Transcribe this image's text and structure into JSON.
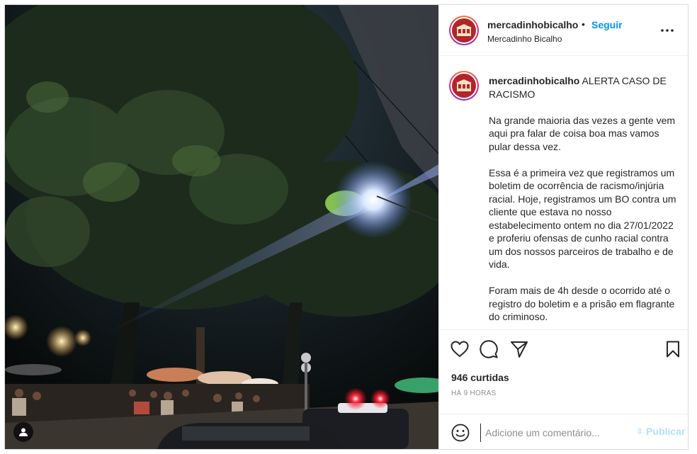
{
  "post": {
    "header": {
      "username": "mercadinhobicalho",
      "separator": "•",
      "follow_label": "Seguir",
      "location": "Mercadinho Bicalho",
      "avatar_icon": "mercadinho-bicalho-logo",
      "more_icon": "more-options-icon"
    },
    "caption": {
      "username": "mercadinhobicalho",
      "first_line": "ALERTA CASO DE RACISMO",
      "paragraphs": [
        "Na grande maioria das vezes a gente vem aqui pra falar de coisa boa mas vamos pular dessa vez.",
        "Essa é a primeira vez que registramos um boletim de ocorrência de racismo/injúria racial. Hoje, registramos um BO contra um cliente que estava no nosso estabelecimento ontem no dia 27/01/2022 e proferiu ofensas de cunho racial contra um dos nossos parceiros de trabalho e de vida.",
        "Foram mais de 4h desde o ocorrido até o registro do boletim e a prisão em flagrante do criminoso."
      ]
    },
    "actions": {
      "like_icon": "heart-icon",
      "comment_icon": "comment-bubble-icon",
      "share_icon": "paper-plane-icon",
      "save_icon": "bookmark-icon"
    },
    "likes": "946 curtidas",
    "time": "HÁ 9 HORAS",
    "comment_box": {
      "emoji_icon": "smiley-icon",
      "placeholder": "Adicione um comentário...",
      "publish_label": "Publicar"
    },
    "photo": {
      "tag_icon": "user-tag-icon"
    }
  },
  "colors": {
    "accent": "#0095f6",
    "publish_disabled": "#b2dffc",
    "text": "#262626",
    "muted": "#8e8e8e",
    "brand_red": "#b5232b"
  }
}
